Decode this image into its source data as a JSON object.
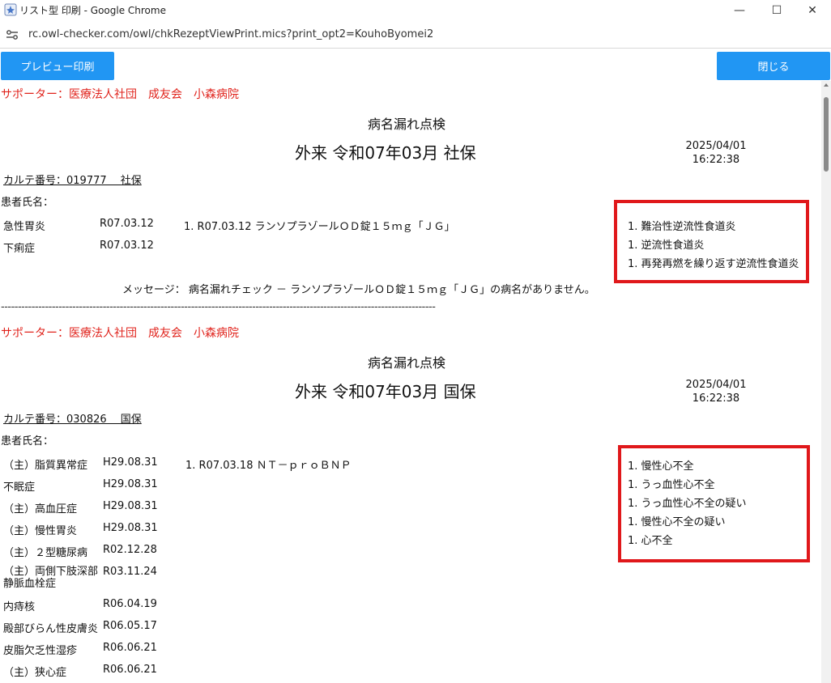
{
  "window": {
    "title": "リスト型 印刷 - Google Chrome",
    "url": "rc.owl-checker.com/owl/chkRezeptViewPrint.mics?print_opt2=KouhoByomei2",
    "min_glyph": "—",
    "max_glyph": "☐",
    "close_glyph": "✕"
  },
  "toolbar": {
    "preview_label": "プレビュー印刷",
    "close_label": "閉じる"
  },
  "records": [
    {
      "supporter": "サポーター：医療法人社団　成友会　小森病院",
      "title": "病名漏れ点検",
      "subtitle": "外来  令和07年03月  社保",
      "date": "2025/04/01",
      "time": "16:22:38",
      "karte": "カルテ番号：019777　 社保",
      "patient_label": "患者氏名：",
      "diagnoses": [
        {
          "name": "急性胃炎",
          "date": "R07.03.12"
        },
        {
          "name": "下痢症",
          "date": "R07.03.12"
        }
      ],
      "medication": "1. R07.03.12 ランソプラゾールＯＤ錠１５ｍｇ「ＪＧ」",
      "candidates": [
        "1. 難治性逆流性食道炎",
        "1. 逆流性食道炎",
        "1. 再発再燃を繰り返す逆流性食道炎"
      ],
      "message": "メッセージ：  病名漏れチェック － ランソプラゾールＯＤ錠１５ｍｇ「ＪＧ」の病名がありません。",
      "divider": "--------------------------------------------------------------------------------------------------------------------------------"
    },
    {
      "supporter": "サポーター：医療法人社団　成友会　小森病院",
      "title": "病名漏れ点検",
      "subtitle": "外来  令和07年03月  国保",
      "date": "2025/04/01",
      "time": "16:22:38",
      "karte": "カルテ番号：030826　 国保",
      "patient_label": "患者氏名：",
      "diagnoses": [
        {
          "name": "（主）脂質異常症",
          "date": "H29.08.31"
        },
        {
          "name": "不眠症",
          "date": "H29.08.31"
        },
        {
          "name": "（主）高血圧症",
          "date": "H29.08.31"
        },
        {
          "name": "（主）慢性胃炎",
          "date": "H29.08.31"
        },
        {
          "name": "（主）２型糖尿病",
          "date": "R02.12.28"
        },
        {
          "name": "（主）両側下肢深部静脈血栓症",
          "date": "R03.11.24"
        },
        {
          "name": "内痔核",
          "date": "R06.04.19"
        },
        {
          "name": "殿部びらん性皮膚炎",
          "date": "R06.05.17"
        },
        {
          "name": "皮脂欠乏性湿疹",
          "date": "R06.06.21"
        },
        {
          "name": "（主）狭心症",
          "date": "R06.06.21"
        }
      ],
      "medication": "1. R07.03.18 ＮＴ－ｐｒｏＢＮＰ",
      "candidates": [
        "1. 慢性心不全",
        "1. うっ血性心不全",
        "1. うっ血性心不全の疑い",
        "1. 慢性心不全の疑い",
        "1. 心不全"
      ]
    }
  ],
  "colors": {
    "accent_button": "#2196f3",
    "supporter_text": "#e0231c",
    "highlight_box": "#e0181b"
  }
}
